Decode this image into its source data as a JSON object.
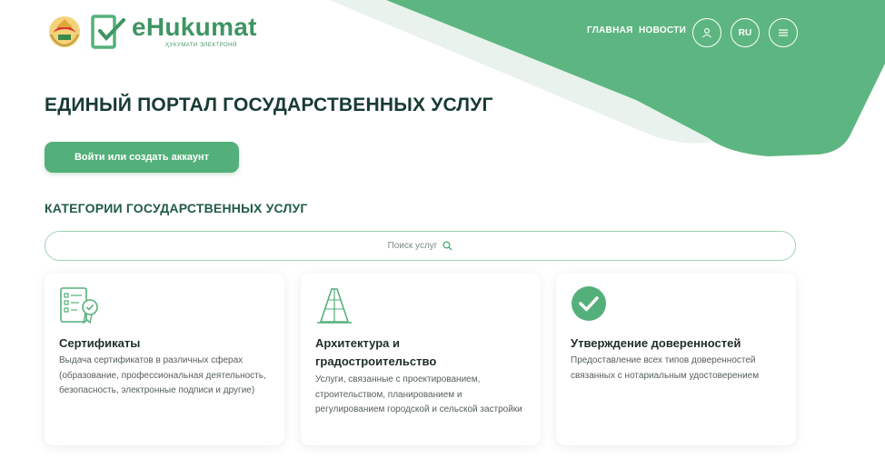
{
  "header": {
    "logo_text": "eHukumat",
    "logo_subtitle": "ҲУКУМАТИ ЭЛЕКТРОНӢ",
    "nav": [
      "ГЛАВНАЯ",
      "НОВОСТИ"
    ],
    "lang": "RU",
    "icons": {
      "user": "user-icon",
      "menu": "menu-icon",
      "emblem": "tajikistan-emblem-icon"
    }
  },
  "hero": {
    "title": "ЕДИНЫЙ ПОРТАЛ ГОСУДАРСТВЕННЫХ УСЛУГ",
    "login_button": "Войти или создать аккаунт"
  },
  "categories": {
    "title": "КАТЕГОРИИ ГОСУДАРСТВЕННЫХ УСЛУГ",
    "search_placeholder": "Поиск услуг",
    "cards": [
      {
        "icon": "certificate-icon",
        "title": "Сертификаты",
        "description": "Выдача сертификатов в различных сферах (образование, профессиональная деятельность, безопасность, электронные подписи и другие)"
      },
      {
        "icon": "architecture-icon",
        "title": "Архитектура и градостроительство",
        "description": "Услуги, связанные с проектированием, строительством, планированием и регулированием городской и сельской застройки"
      },
      {
        "icon": "check-circle-icon",
        "title": "Утверждение доверенностей",
        "description": "Предоставление всех типов доверенностей связанных с нотариальным удостоверением"
      }
    ]
  },
  "colors": {
    "brand_green": "#54b07a",
    "dark_text": "#173b34",
    "light_green_bg": "#e9f2ed"
  }
}
